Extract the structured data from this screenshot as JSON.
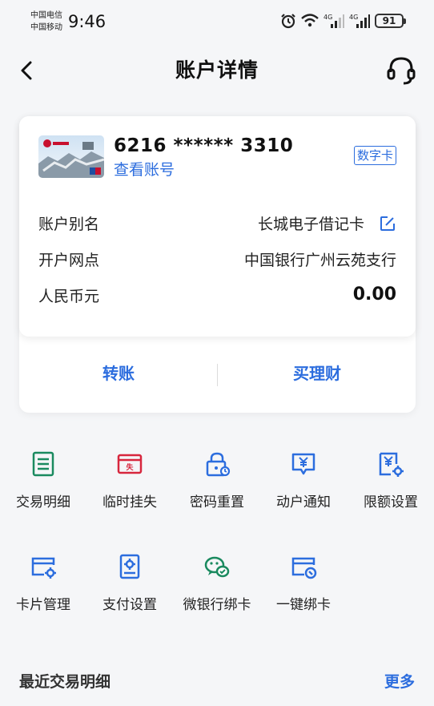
{
  "status_bar": {
    "carrier_1": "中国电信",
    "carrier_2": "中国移动",
    "time": "9:46",
    "network_1": "4G",
    "network_2": "4G",
    "battery": "91"
  },
  "header": {
    "title": "账户详情"
  },
  "account": {
    "card_number": "6216 ****** 3310",
    "view_account_label": "查看账号",
    "digital_badge": "数字卡",
    "alias_label": "账户别名",
    "alias_value": "长城电子借记卡",
    "branch_label": "开户网点",
    "branch_value": "中国银行广州云苑支行",
    "currency_label": "人民币元",
    "balance": "0.00"
  },
  "actions": {
    "transfer": "转账",
    "buy_wealth": "买理财"
  },
  "grid": [
    {
      "label": "交易明细",
      "icon": "ledger-icon",
      "color": "#1a8a5f"
    },
    {
      "label": "临时挂失",
      "icon": "lost-card-icon",
      "color": "#d7263d"
    },
    {
      "label": "密码重置",
      "icon": "lock-reset-icon",
      "color": "#2c6dde"
    },
    {
      "label": "动户通知",
      "icon": "yuan-notice-icon",
      "color": "#2c6dde"
    },
    {
      "label": "限额设置",
      "icon": "yuan-settings-icon",
      "color": "#2c6dde"
    },
    {
      "label": "卡片管理",
      "icon": "card-settings-icon",
      "color": "#2c6dde"
    },
    {
      "label": "支付设置",
      "icon": "payment-settings-icon",
      "color": "#2c6dde"
    },
    {
      "label": "微银行绑卡",
      "icon": "wechat-bind-icon",
      "color": "#1a8a5f"
    },
    {
      "label": "一键绑卡",
      "icon": "quick-bind-card-icon",
      "color": "#2c6dde"
    }
  ],
  "recent": {
    "title": "最近交易明细",
    "more_label": "更多"
  },
  "colors": {
    "accent": "#2c6dde",
    "green": "#1a8a5f",
    "red": "#d7263d"
  }
}
